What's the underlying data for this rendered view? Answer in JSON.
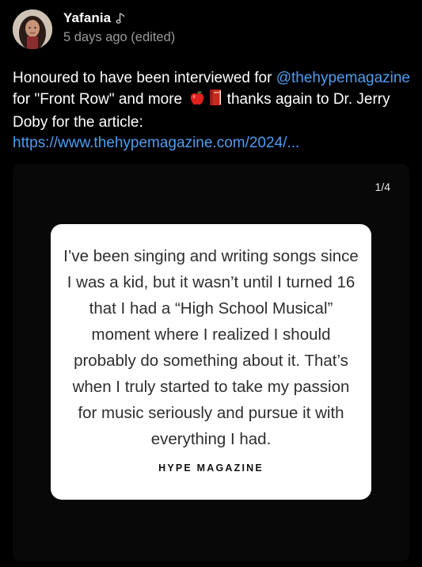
{
  "post": {
    "username": "Yafania",
    "badge_icon": "music-note-icon",
    "timestamp": "5 days ago (edited)",
    "caption": {
      "lead": "Honoured to have been interviewed for",
      "mention": "@thehypemagazine",
      "middle": " for \"Front Row\" and more ",
      "tail": " thanks again to Dr. Jerry Doby for the article: ",
      "link": "https://www.thehypemagazine.com/2024/..."
    },
    "emojis": [
      "apple-icon",
      "book-icon"
    ]
  },
  "carousel": {
    "counter": "1/4",
    "quote": "I’ve been singing and writing songs since I was a kid, but it wasn’t until I turned 16 that I had a “High School Musical” moment where I realized I should probably do something about it. That’s when I truly started to take my passion for music seriously and pursue it with everything I had.",
    "source": "HYPE MAGAZINE"
  },
  "colors": {
    "background": "#000000",
    "link": "#4c9ef2",
    "muted": "#9a9a9a",
    "card": "#080808",
    "quote_bg": "#ffffff"
  }
}
